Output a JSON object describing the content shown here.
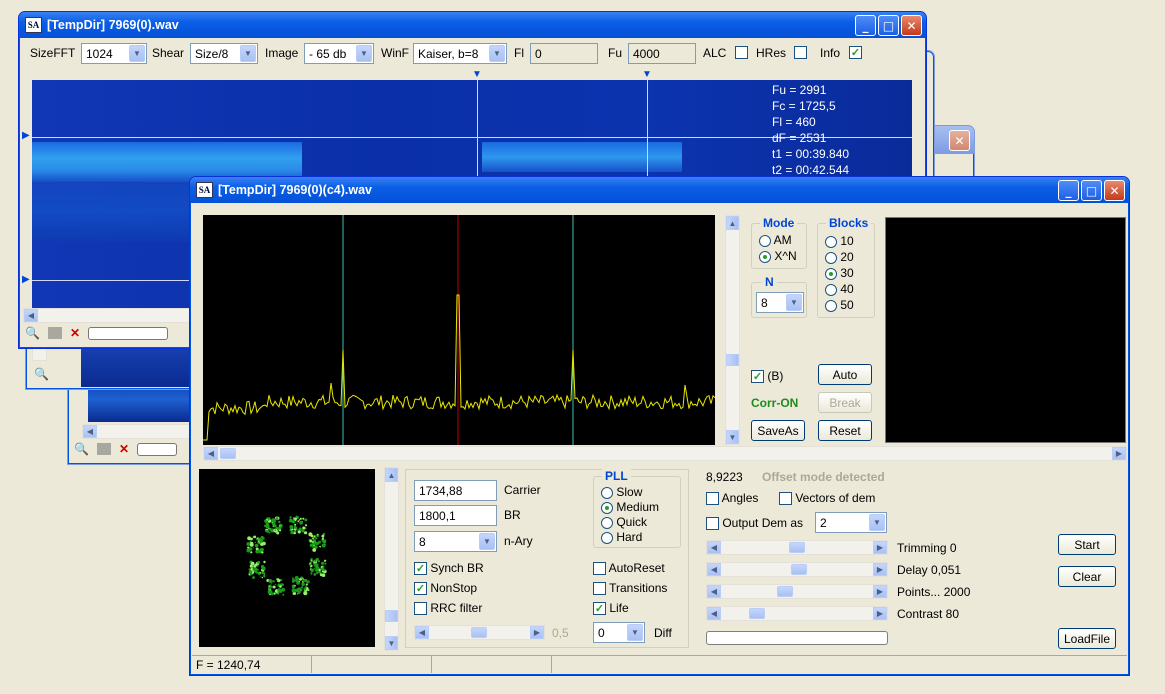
{
  "win1": {
    "title": "[TempDir] 7969(0).wav",
    "sizefft_label": "SizeFFT",
    "sizefft": "1024",
    "shear_label": "Shear",
    "shear": "Size/8",
    "image_label": "Image",
    "image": "- 65 db",
    "winf_label": "WinF",
    "winf": "Kaiser, b=8",
    "fl_label": "Fl",
    "fl": "0",
    "fu_label": "Fu",
    "fu": "4000",
    "alc_label": "ALC",
    "hres_label": "HRes",
    "info_label": "Info",
    "overlay": [
      "Fu = 2991",
      "Fc = 1725,5",
      "Fl = 460",
      "dF = 2531",
      "t1 = 00:39.840",
      "t2 = 00:42.544"
    ]
  },
  "win2": {
    "title": "[TempDir] 7969(0)(c4).wav",
    "mode_title": "Mode",
    "mode_am": "AM",
    "mode_xn": "X^N",
    "n_title": "N",
    "n_value": "8",
    "blocks_title": "Blocks",
    "blocks": [
      "10",
      "20",
      "30",
      "40",
      "50"
    ],
    "blocks_selected": "30",
    "b_label": "(B)",
    "corr": "Corr-ON",
    "auto": "Auto",
    "break": "Break",
    "saveas": "SaveAs",
    "reset": "Reset",
    "carrier": "1734,88",
    "carrier_label": "Carrier",
    "br": "1800,1",
    "br_label": "BR",
    "nary": "8",
    "nary_label": "n-Ary",
    "pll_title": "PLL",
    "pll": [
      "Slow",
      "Medium",
      "Quick",
      "Hard"
    ],
    "pll_selected": "Medium",
    "synch": "Synch BR",
    "nonstop": "NonStop",
    "rrc": "RRC filter",
    "autoreset": "AutoReset",
    "transitions": "Transitions",
    "life": "Life",
    "slider_val": "0,5",
    "diff_value": "0",
    "diff_label": "Diff",
    "offset_val": "8,9223",
    "offset_msg": "Offset mode detected",
    "angles": "Angles",
    "vectors": "Vectors of dem",
    "output": "Output Dem as",
    "output_val": "2",
    "trimming": "Trimming 0",
    "delay": "Delay  0,051",
    "points": "Points... 2000",
    "contrast": "Contrast 80",
    "start": "Start",
    "clear": "Clear",
    "loadfile": "LoadFile",
    "status": "F = 1240,74"
  },
  "colors": {
    "spectrum": "#e8e800",
    "marker_center": "#c00000",
    "marker_side": "#40c0b0",
    "constellation": "#22dd22"
  }
}
